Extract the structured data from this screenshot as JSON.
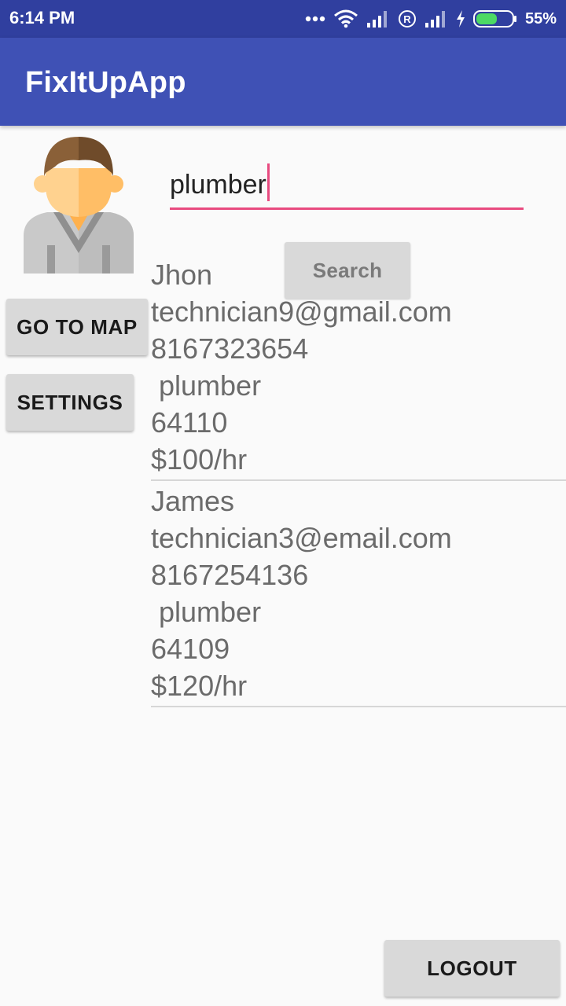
{
  "status_bar": {
    "time": "6:14 PM",
    "battery_percent": "55%",
    "icons": [
      "more-dots-icon",
      "wifi-icon",
      "signal-icon",
      "roaming-icon",
      "signal-icon",
      "charging-icon",
      "battery-icon"
    ]
  },
  "app_bar": {
    "title": "FixItUpApp"
  },
  "avatar": {
    "icon": "technician-avatar-icon"
  },
  "search": {
    "value": "plumber",
    "button_label": "Search"
  },
  "buttons": {
    "go_to_map": "GO TO MAP",
    "settings": "SETTINGS",
    "logout": "LOGOUT"
  },
  "results": [
    {
      "name": "Jhon",
      "email": "technician9@gmail.com",
      "phone": "8167323654",
      "trade": " plumber",
      "zip": "64110",
      "rate": "$100/hr"
    },
    {
      "name": "James",
      "email": "technician3@email.com",
      "phone": "8167254136",
      "trade": " plumber",
      "zip": "64109",
      "rate": "$120/hr"
    }
  ],
  "colors": {
    "status_bar": "#303f9f",
    "app_bar": "#3f51b5",
    "accent": "#e84a7f",
    "button": "#d9d9d9"
  }
}
